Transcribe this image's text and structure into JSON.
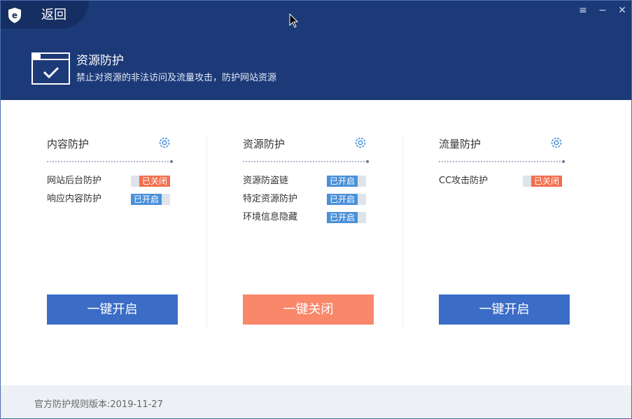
{
  "header": {
    "back_label": "返回",
    "title": "资源防护",
    "description": "禁止对资源的非法访问及流量攻击，防护网站资源",
    "window_controls": [
      "≡",
      "−",
      "✕"
    ]
  },
  "panels": [
    {
      "title": "内容防护",
      "items": [
        {
          "label": "网站后台防护",
          "state": "已关闭"
        },
        {
          "label": "响应内容防护",
          "state": "已开启"
        }
      ],
      "button_label": "一键开启"
    },
    {
      "title": "资源防护",
      "items": [
        {
          "label": "资源防盗链",
          "state": "已开启"
        },
        {
          "label": "特定资源防护",
          "state": "已开启"
        },
        {
          "label": "环境信息隐藏",
          "state": "已开启"
        }
      ],
      "button_label": "一键关闭"
    },
    {
      "title": "流量防护",
      "items": [
        {
          "label": "CC攻击防护",
          "state": "已关闭"
        }
      ],
      "button_label": "一键开启"
    }
  ],
  "footer": {
    "version_text": "官方防护规则版本:2019-11-27"
  },
  "colors": {
    "header_bg": "#1d3a78",
    "on": "#4a90d9",
    "off": "#f36f4e",
    "primary_button": "#3b6dc7",
    "danger_button": "#f9876a"
  },
  "icons": [
    "app-logo-icon",
    "menu-icon",
    "minimize-icon",
    "close-icon",
    "browser-check-icon",
    "gear-icon"
  ]
}
